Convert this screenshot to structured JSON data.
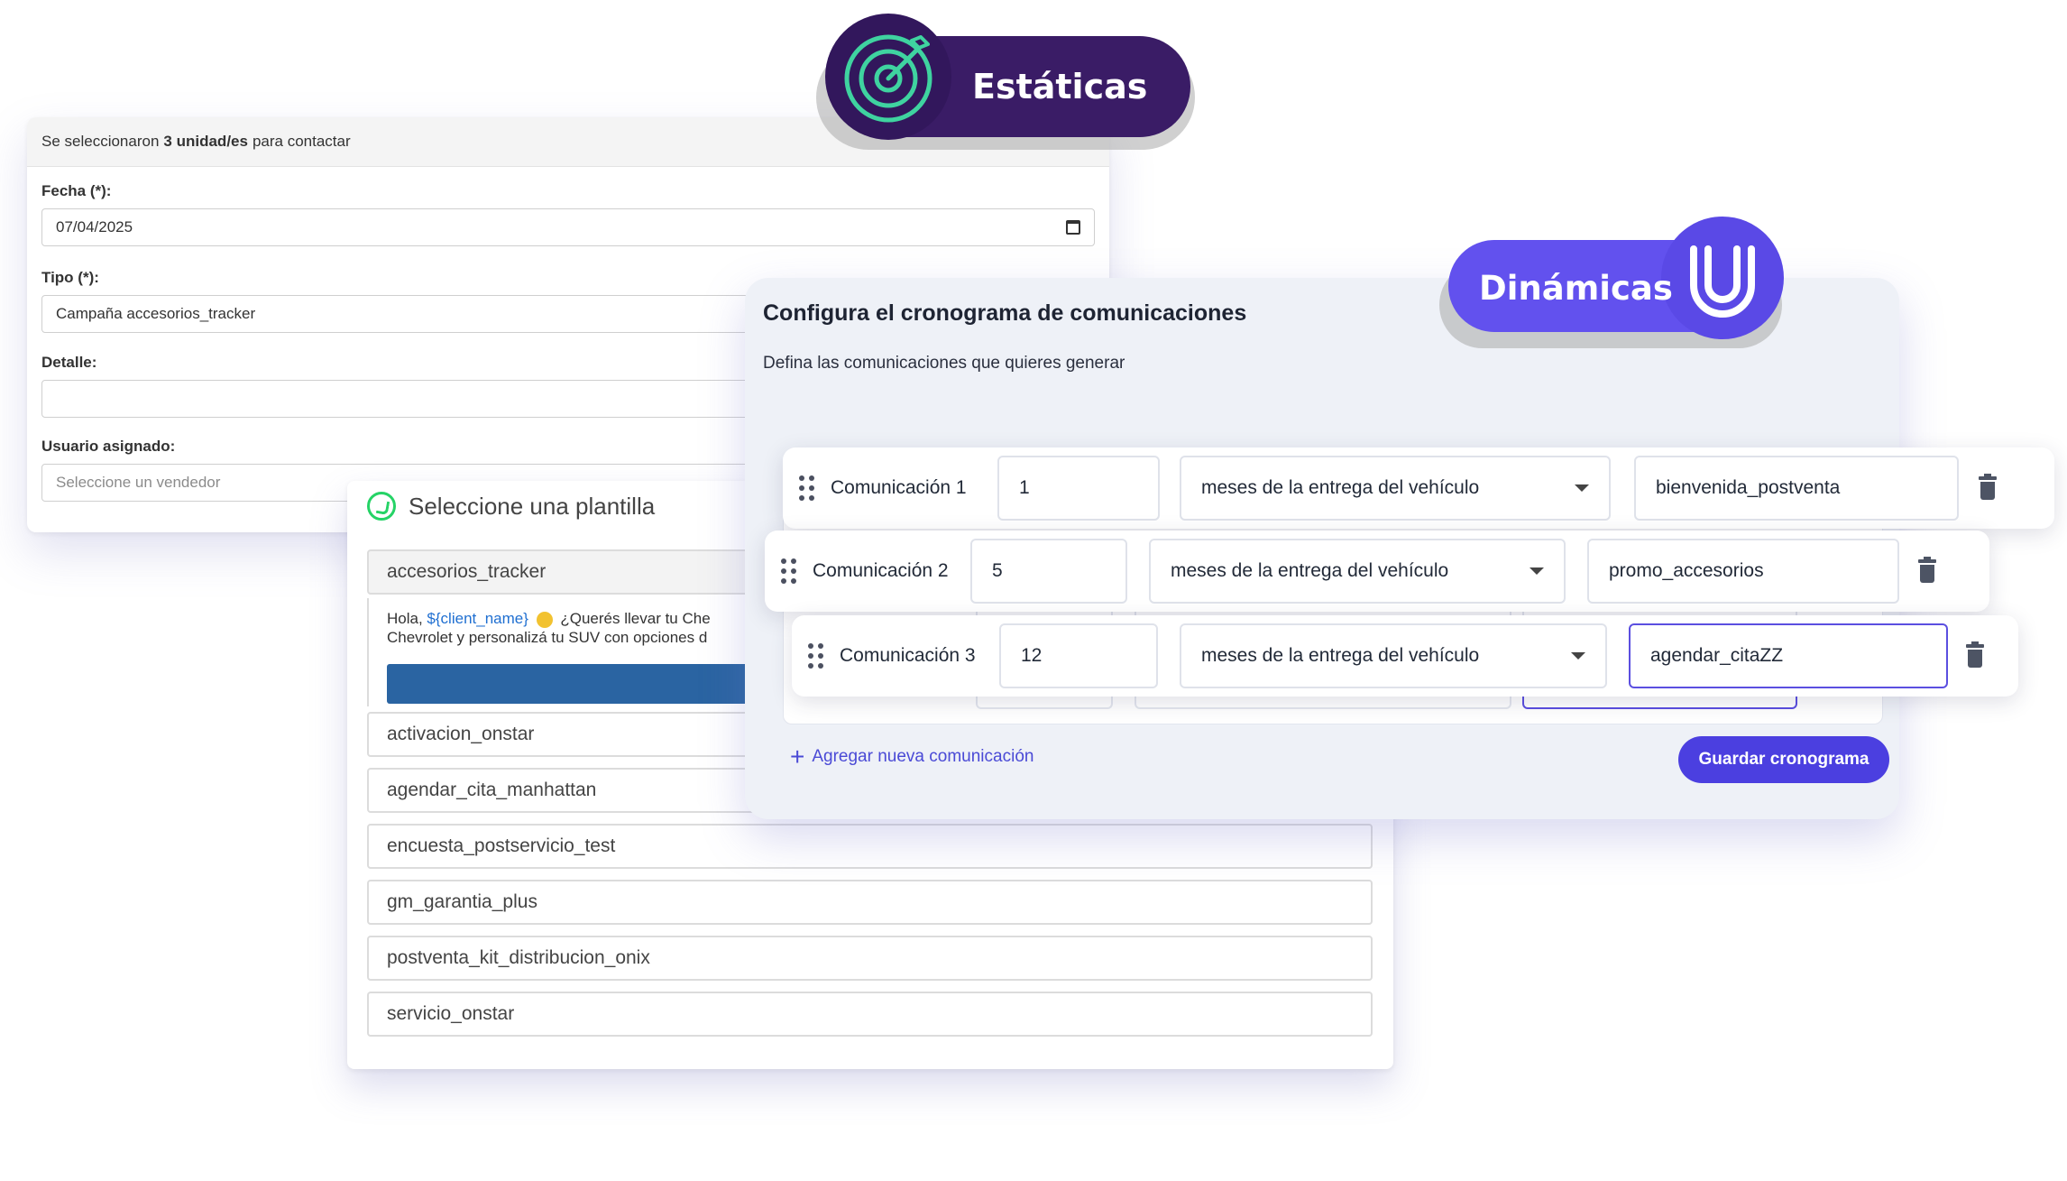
{
  "static_form": {
    "top_prefix": "Se seleccionaron",
    "top_bold": "3 unidad/es",
    "top_suffix": "para contactar",
    "fecha_label": "Fecha (*):",
    "fecha_value": "07/04/2025",
    "tipo_label": "Tipo (*):",
    "tipo_value": "Campaña accesorios_tracker",
    "detalle_label": "Detalle:",
    "detalle_value": "",
    "usuario_label": "Usuario asignado:",
    "usuario_placeholder": "Seleccione un vendedor"
  },
  "template_picker": {
    "title": "Seleccione una plantilla",
    "selected": "accesorios_tracker",
    "preview_line1_a": "Hola,",
    "preview_var": "${client_name}",
    "preview_line1_b": "¿Querés llevar tu Che",
    "preview_line2": "Chevrolet y personalizá tu SUV con opciones d",
    "items": [
      "activacion_onstar",
      "agendar_cita_manhattan",
      "encuesta_postservicio_test",
      "gm_garantia_plus",
      "postventa_kit_distribucion_onix",
      "servicio_onstar"
    ]
  },
  "scheduler": {
    "title": "Configura el cronograma de comunicaciones",
    "subtitle": "Defina las comunicaciones que quieres generar",
    "rows": [
      {
        "label": "Comunicación 1",
        "number": "1",
        "unit": "meses de la entrega del vehículo",
        "template": "bienvenida_postventa"
      },
      {
        "label": "Comunicación 2",
        "number": "5",
        "unit": "meses de la entrega del vehículo",
        "template": "promo_accesorios"
      },
      {
        "label": "Comunicación 3",
        "number": "12",
        "unit": "meses de la entrega del vehículo",
        "template": "agendar_citaZZ"
      }
    ],
    "add_label": "Agregar nueva comunicación",
    "save_label": "Guardar cronograma"
  },
  "badges": {
    "static_label": "Estáticas",
    "dynamic_label": "Dinámicas",
    "static_icon": "target-icon",
    "dynamic_icon": "magnet-icon"
  },
  "colors": {
    "static_badge": "#3a1c66",
    "dynamic_badge": "#6251ee",
    "accent": "#4b3fe0",
    "whatsapp": "#25d366"
  }
}
